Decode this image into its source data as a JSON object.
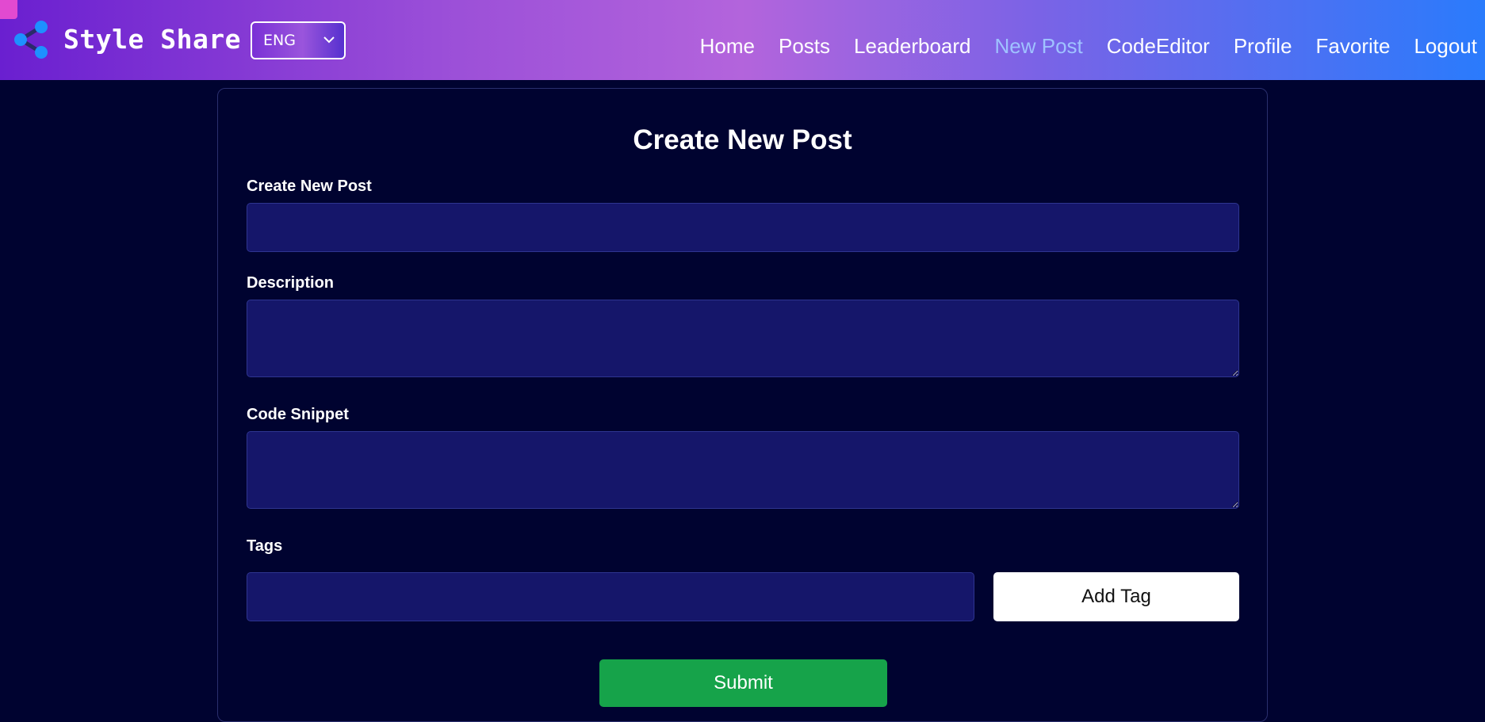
{
  "navbar": {
    "brand": "Style Share",
    "language": {
      "selected": "ENG"
    },
    "links": [
      {
        "label": "Home"
      },
      {
        "label": "Posts"
      },
      {
        "label": "Leaderboard"
      },
      {
        "label": "New Post",
        "active": true
      },
      {
        "label": "CodeEditor"
      },
      {
        "label": "Profile"
      },
      {
        "label": "Favorite"
      },
      {
        "label": "Logout"
      }
    ],
    "colors": {
      "gradient_start": "#6a1fd0",
      "gradient_mid": "#b364dc",
      "gradient_end": "#2a7bfc",
      "active_link": "#9fc2ff"
    }
  },
  "form": {
    "title": "Create New Post",
    "fields": {
      "post_title": {
        "label": "Create New Post",
        "value": ""
      },
      "description": {
        "label": "Description",
        "value": ""
      },
      "code_snippet": {
        "label": "Code Snippet",
        "value": ""
      },
      "tags": {
        "label": "Tags",
        "value": ""
      }
    },
    "add_tag_label": "Add Tag",
    "submit_label": "Submit",
    "colors": {
      "page_bg": "#000330",
      "input_bg": "#15166a",
      "submit_bg": "#16a34a"
    }
  },
  "icons": {
    "logo": "share-icon",
    "lang_dropdown": "chevron-down-icon"
  }
}
